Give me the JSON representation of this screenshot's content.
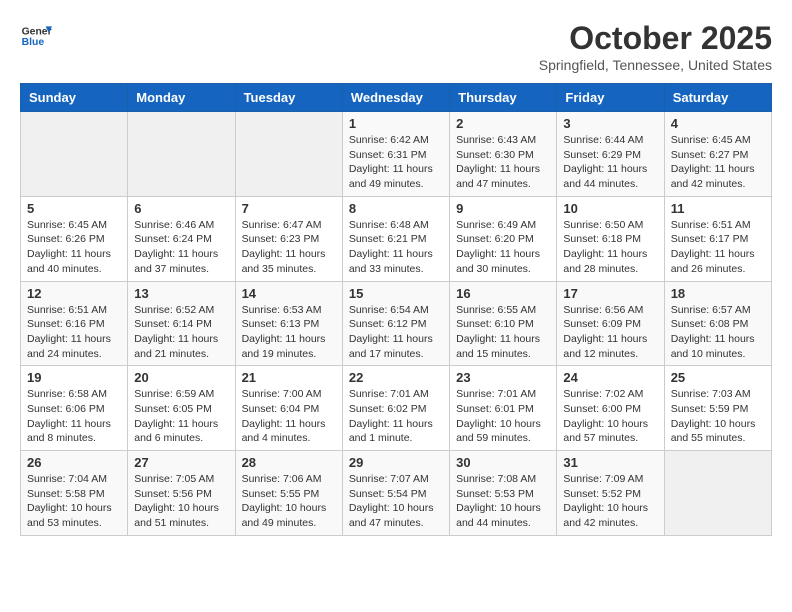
{
  "logo": {
    "line1": "General",
    "line2": "Blue"
  },
  "title": "October 2025",
  "location": "Springfield, Tennessee, United States",
  "weekdays": [
    "Sunday",
    "Monday",
    "Tuesday",
    "Wednesday",
    "Thursday",
    "Friday",
    "Saturday"
  ],
  "weeks": [
    [
      {
        "day": "",
        "info": ""
      },
      {
        "day": "",
        "info": ""
      },
      {
        "day": "",
        "info": ""
      },
      {
        "day": "1",
        "info": "Sunrise: 6:42 AM\nSunset: 6:31 PM\nDaylight: 11 hours\nand 49 minutes."
      },
      {
        "day": "2",
        "info": "Sunrise: 6:43 AM\nSunset: 6:30 PM\nDaylight: 11 hours\nand 47 minutes."
      },
      {
        "day": "3",
        "info": "Sunrise: 6:44 AM\nSunset: 6:29 PM\nDaylight: 11 hours\nand 44 minutes."
      },
      {
        "day": "4",
        "info": "Sunrise: 6:45 AM\nSunset: 6:27 PM\nDaylight: 11 hours\nand 42 minutes."
      }
    ],
    [
      {
        "day": "5",
        "info": "Sunrise: 6:45 AM\nSunset: 6:26 PM\nDaylight: 11 hours\nand 40 minutes."
      },
      {
        "day": "6",
        "info": "Sunrise: 6:46 AM\nSunset: 6:24 PM\nDaylight: 11 hours\nand 37 minutes."
      },
      {
        "day": "7",
        "info": "Sunrise: 6:47 AM\nSunset: 6:23 PM\nDaylight: 11 hours\nand 35 minutes."
      },
      {
        "day": "8",
        "info": "Sunrise: 6:48 AM\nSunset: 6:21 PM\nDaylight: 11 hours\nand 33 minutes."
      },
      {
        "day": "9",
        "info": "Sunrise: 6:49 AM\nSunset: 6:20 PM\nDaylight: 11 hours\nand 30 minutes."
      },
      {
        "day": "10",
        "info": "Sunrise: 6:50 AM\nSunset: 6:18 PM\nDaylight: 11 hours\nand 28 minutes."
      },
      {
        "day": "11",
        "info": "Sunrise: 6:51 AM\nSunset: 6:17 PM\nDaylight: 11 hours\nand 26 minutes."
      }
    ],
    [
      {
        "day": "12",
        "info": "Sunrise: 6:51 AM\nSunset: 6:16 PM\nDaylight: 11 hours\nand 24 minutes."
      },
      {
        "day": "13",
        "info": "Sunrise: 6:52 AM\nSunset: 6:14 PM\nDaylight: 11 hours\nand 21 minutes."
      },
      {
        "day": "14",
        "info": "Sunrise: 6:53 AM\nSunset: 6:13 PM\nDaylight: 11 hours\nand 19 minutes."
      },
      {
        "day": "15",
        "info": "Sunrise: 6:54 AM\nSunset: 6:12 PM\nDaylight: 11 hours\nand 17 minutes."
      },
      {
        "day": "16",
        "info": "Sunrise: 6:55 AM\nSunset: 6:10 PM\nDaylight: 11 hours\nand 15 minutes."
      },
      {
        "day": "17",
        "info": "Sunrise: 6:56 AM\nSunset: 6:09 PM\nDaylight: 11 hours\nand 12 minutes."
      },
      {
        "day": "18",
        "info": "Sunrise: 6:57 AM\nSunset: 6:08 PM\nDaylight: 11 hours\nand 10 minutes."
      }
    ],
    [
      {
        "day": "19",
        "info": "Sunrise: 6:58 AM\nSunset: 6:06 PM\nDaylight: 11 hours\nand 8 minutes."
      },
      {
        "day": "20",
        "info": "Sunrise: 6:59 AM\nSunset: 6:05 PM\nDaylight: 11 hours\nand 6 minutes."
      },
      {
        "day": "21",
        "info": "Sunrise: 7:00 AM\nSunset: 6:04 PM\nDaylight: 11 hours\nand 4 minutes."
      },
      {
        "day": "22",
        "info": "Sunrise: 7:01 AM\nSunset: 6:02 PM\nDaylight: 11 hours\nand 1 minute."
      },
      {
        "day": "23",
        "info": "Sunrise: 7:01 AM\nSunset: 6:01 PM\nDaylight: 10 hours\nand 59 minutes."
      },
      {
        "day": "24",
        "info": "Sunrise: 7:02 AM\nSunset: 6:00 PM\nDaylight: 10 hours\nand 57 minutes."
      },
      {
        "day": "25",
        "info": "Sunrise: 7:03 AM\nSunset: 5:59 PM\nDaylight: 10 hours\nand 55 minutes."
      }
    ],
    [
      {
        "day": "26",
        "info": "Sunrise: 7:04 AM\nSunset: 5:58 PM\nDaylight: 10 hours\nand 53 minutes."
      },
      {
        "day": "27",
        "info": "Sunrise: 7:05 AM\nSunset: 5:56 PM\nDaylight: 10 hours\nand 51 minutes."
      },
      {
        "day": "28",
        "info": "Sunrise: 7:06 AM\nSunset: 5:55 PM\nDaylight: 10 hours\nand 49 minutes."
      },
      {
        "day": "29",
        "info": "Sunrise: 7:07 AM\nSunset: 5:54 PM\nDaylight: 10 hours\nand 47 minutes."
      },
      {
        "day": "30",
        "info": "Sunrise: 7:08 AM\nSunset: 5:53 PM\nDaylight: 10 hours\nand 44 minutes."
      },
      {
        "day": "31",
        "info": "Sunrise: 7:09 AM\nSunset: 5:52 PM\nDaylight: 10 hours\nand 42 minutes."
      },
      {
        "day": "",
        "info": ""
      }
    ]
  ]
}
